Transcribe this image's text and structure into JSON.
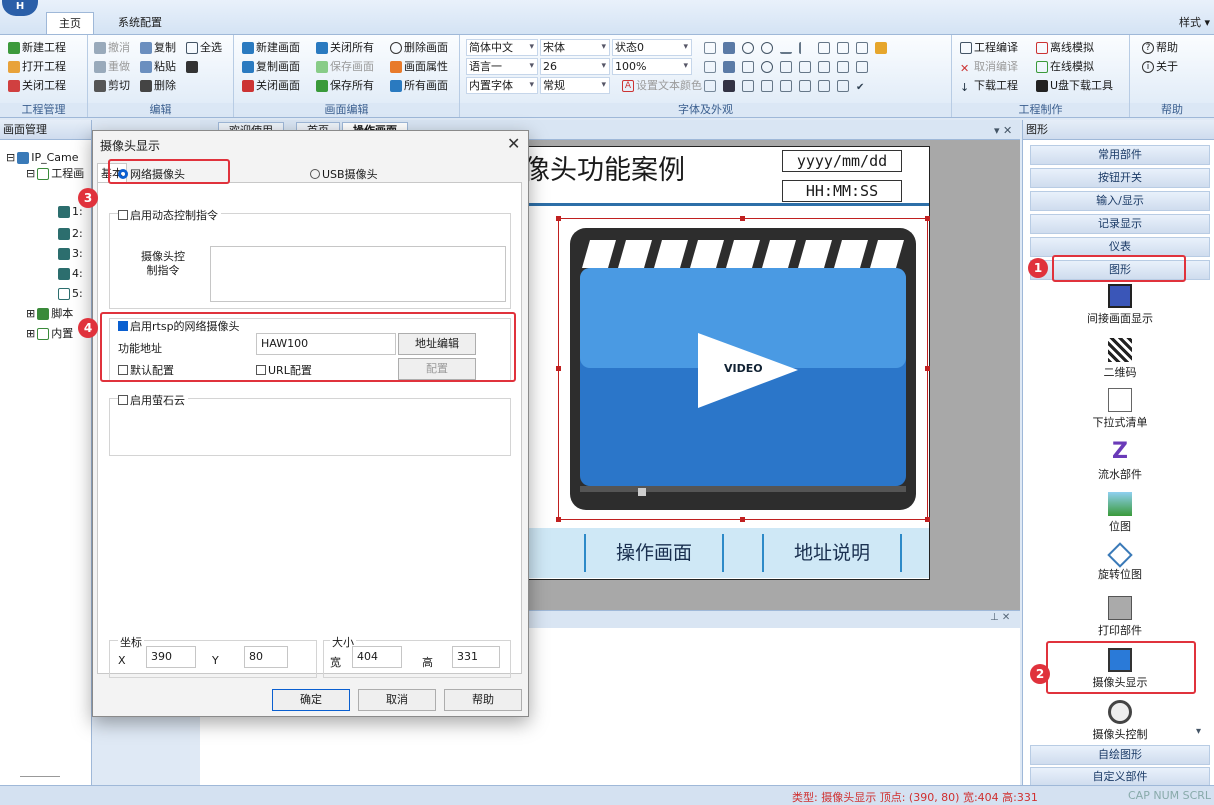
{
  "ribbon": {
    "tabs": [
      "主页",
      "系统配置"
    ],
    "style_menu": "样式",
    "project_mgmt": {
      "items": [
        "新建工程",
        "打开工程",
        "关闭工程"
      ],
      "label": "工程管理"
    },
    "edit": {
      "items": [
        "撤消",
        "复制",
        "全选",
        "重做",
        "粘贴",
        "剪切",
        "删除"
      ],
      "label": "编辑"
    },
    "screen_edit": {
      "items": [
        "新建画面",
        "关闭所有",
        "删除画面",
        "复制画面",
        "保存画面",
        "画面属性",
        "关闭画面",
        "保存所有",
        "所有画面"
      ],
      "label": "画面编辑"
    },
    "font": {
      "lang_combo": "简体中文",
      "font_combo": "宋体",
      "state_combo": "状态0",
      "lang2_combo": "语言一",
      "size_combo": "26",
      "zoom_combo": "100%",
      "builtin_combo": "内置字体",
      "weight_combo": "常规",
      "text_color": "设置文本颜色",
      "label": "字体及外观"
    },
    "build": {
      "items": [
        "工程编译",
        "离线模拟",
        "取消编译",
        "在线模拟",
        "下载工程",
        "U盘下载工具"
      ],
      "label": "工程制作"
    },
    "help": {
      "items": [
        "帮助",
        "关于"
      ],
      "label": "帮助"
    }
  },
  "left_panel": {
    "title": "画面管理",
    "tree": [
      "IP_Came",
      "工程画",
      "1:",
      "2:",
      "3:",
      "4:",
      "5:",
      "脚本",
      "内置"
    ]
  },
  "page_tabs": [
    "欢迎使用",
    "首页",
    "操作画面"
  ],
  "screen": {
    "title": "像头功能案例",
    "date": "yyyy/mm/dd",
    "time": "HH:MM:SS",
    "video_label": "VIDEO",
    "buttons": [
      "操作画面",
      "地址说明"
    ]
  },
  "dialog": {
    "title": "摄像头显示",
    "tab": "基本",
    "radio_network": "网络摄像头",
    "radio_usb": "USB摄像头",
    "dynamic_ctrl": "启用动态控制指令",
    "ctrl_label": "摄像头控制指令",
    "rtsp_check": "启用rtsp的网络摄像头",
    "func_addr_label": "功能地址",
    "func_addr_value": "HAW100",
    "addr_edit_btn": "地址编辑",
    "default_cfg": "默认配置",
    "url_cfg": "URL配置",
    "cfg_btn": "配置",
    "ezviz": "启用萤石云",
    "coord_label": "坐标",
    "x_label": "X",
    "x_value": "390",
    "y_label": "Y",
    "y_value": "80",
    "size_label": "大小",
    "w_label": "宽",
    "w_value": "404",
    "h_label": "高",
    "h_value": "331",
    "ok": "确定",
    "cancel": "取消",
    "help": "帮助"
  },
  "right_panel": {
    "title": "图形",
    "categories_top": [
      "常用部件",
      "按钮开关",
      "输入/显示",
      "记录显示",
      "仪表",
      "图形"
    ],
    "tools": [
      "间接画面显示",
      "二维码",
      "下拉式清单",
      "流水部件",
      "位图",
      "旋转位图",
      "打印部件",
      "摄像头显示",
      "摄像头控制"
    ],
    "categories_bottom": [
      "自绘图形",
      "自定义部件"
    ]
  },
  "badges": [
    "1",
    "2",
    "3",
    "4"
  ],
  "status": {
    "text": "类型: 摄像头显示   顶点: (390, 80)   宽:404   高:331",
    "keys": "CAP NUM SCRL"
  },
  "colors": {
    "highlight": "#e0323c",
    "accent": "#2d6fa8",
    "ribbon": "#dde9f6"
  }
}
